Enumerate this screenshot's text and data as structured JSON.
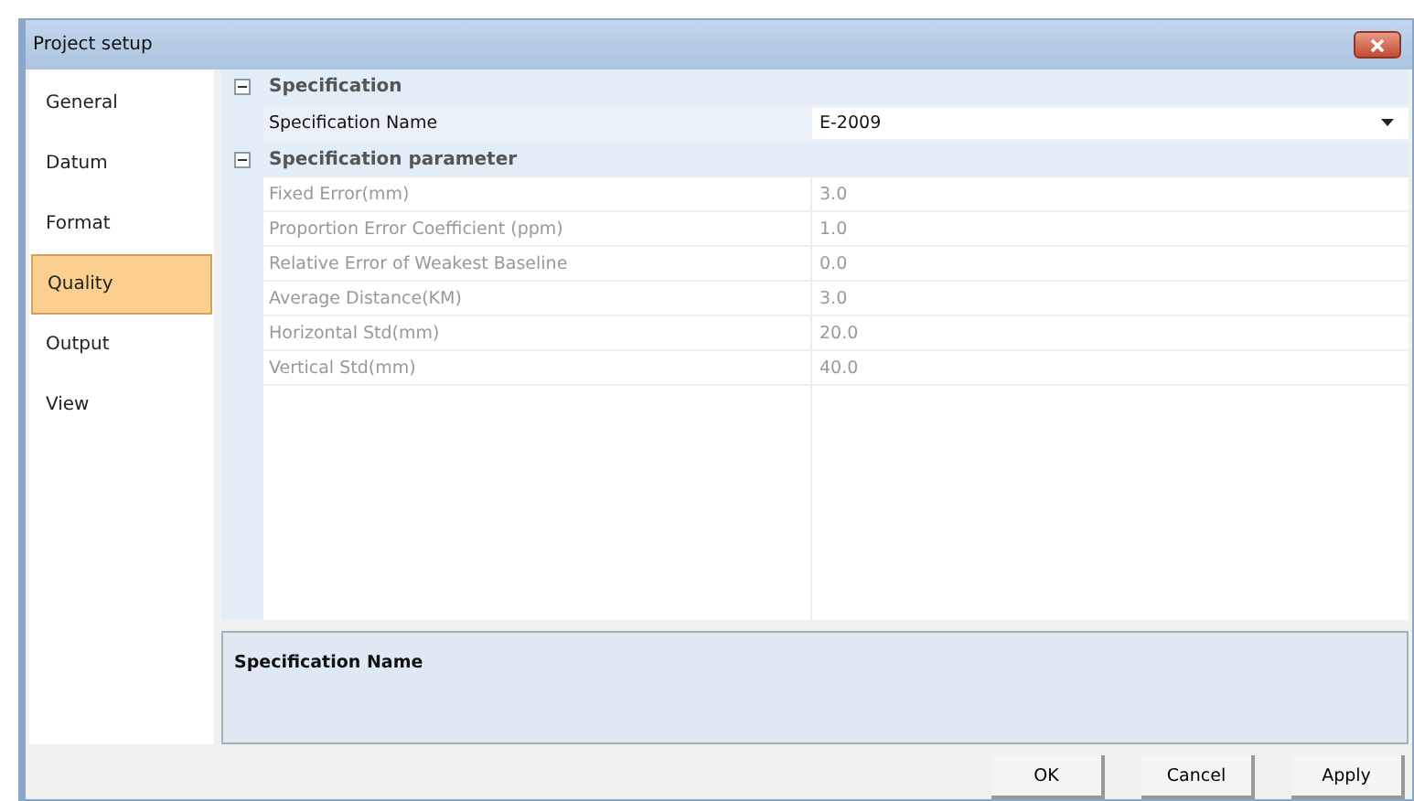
{
  "window": {
    "title": "Project setup"
  },
  "sidebar": {
    "items": [
      {
        "label": "General",
        "selected": false
      },
      {
        "label": "Datum",
        "selected": false
      },
      {
        "label": "Format",
        "selected": false
      },
      {
        "label": "Quality",
        "selected": true
      },
      {
        "label": "Output",
        "selected": false
      },
      {
        "label": "View",
        "selected": false
      }
    ]
  },
  "grid": {
    "categories": [
      {
        "label": "Specification",
        "expanded": true,
        "properties": [
          {
            "name": "Specification Name",
            "value": "E-2009",
            "kind": "dropdown",
            "disabled": false
          }
        ]
      },
      {
        "label": "Specification parameter",
        "expanded": true,
        "properties": [
          {
            "name": "Fixed Error(mm)",
            "value": "3.0",
            "kind": "text",
            "disabled": true
          },
          {
            "name": "Proportion Error Coefficient (ppm)",
            "value": "1.0",
            "kind": "text",
            "disabled": true
          },
          {
            "name": "Relative Error of Weakest Baseline",
            "value": "0.0",
            "kind": "text",
            "disabled": true
          },
          {
            "name": "Average Distance(KM)",
            "value": "3.0",
            "kind": "text",
            "disabled": true
          },
          {
            "name": "Horizontal Std(mm)",
            "value": "20.0",
            "kind": "text",
            "disabled": true
          },
          {
            "name": "Vertical Std(mm)",
            "value": "40.0",
            "kind": "text",
            "disabled": true
          }
        ]
      }
    ]
  },
  "description": {
    "title": "Specification Name"
  },
  "buttons": [
    "OK",
    "Cancel",
    "Apply"
  ]
}
